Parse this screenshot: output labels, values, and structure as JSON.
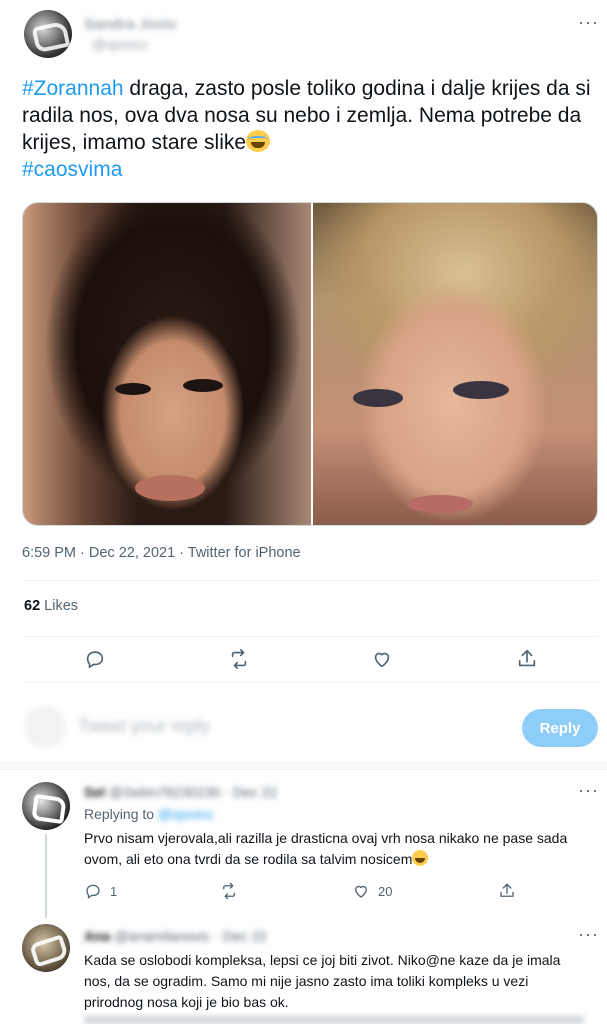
{
  "main_tweet": {
    "author_name": "Sandra Jovic",
    "author_handle": "@sjovicc",
    "more": "···",
    "hashtag_1": "#Zorannah",
    "text_1": " draga, zasto posle toliko godina i dalje krijes da si radila nos, ova dva nosa su nebo i zemlja. Nema potrebe da krijes, imamo stare slike",
    "emoji": "crying-face",
    "hashtag_2": "#caosvima",
    "timestamp": "6:59 PM · Dec 22, 2021 · Twitter for iPhone",
    "likes_count": "62",
    "likes_label": " Likes",
    "actions": [
      "reply-icon",
      "retweet-icon",
      "like-icon",
      "share-icon"
    ]
  },
  "reply_composer": {
    "placeholder": "Tweet your reply",
    "button_label": "Reply"
  },
  "replies": [
    {
      "author": "Sel",
      "handle_date": "@Selim76230230 · Dec 22",
      "replying_to_label": "Replying to",
      "replying_to_handle": "@sjovicc",
      "text": "Prvo nisam vjerovala,ali razilla je drasticna ovaj vrh nosa nikako ne pase sada ovom, ali eto ona tvrdi da se rodila sa talvim nosicem",
      "emoji": "grinning-squinting-face",
      "reply_count": "1",
      "retweet_count": "",
      "like_count": "20"
    },
    {
      "author": "Ana",
      "handle_date": "@anamilanovic · Dec 22",
      "text": "Kada se oslobodi kompleksa, lepsi ce joj biti zivot. Niko@ne kaze da je imala nos, da se ogradim. Samo mi nije jasno zasto ima toliki kompleks u vezi prirodnog nosa koji je bio bas ok."
    }
  ],
  "colors": {
    "link": "#1d9bf0",
    "secondary_text": "#536471",
    "primary_text": "#0f1419",
    "reply_button": "#8ecdf8"
  }
}
